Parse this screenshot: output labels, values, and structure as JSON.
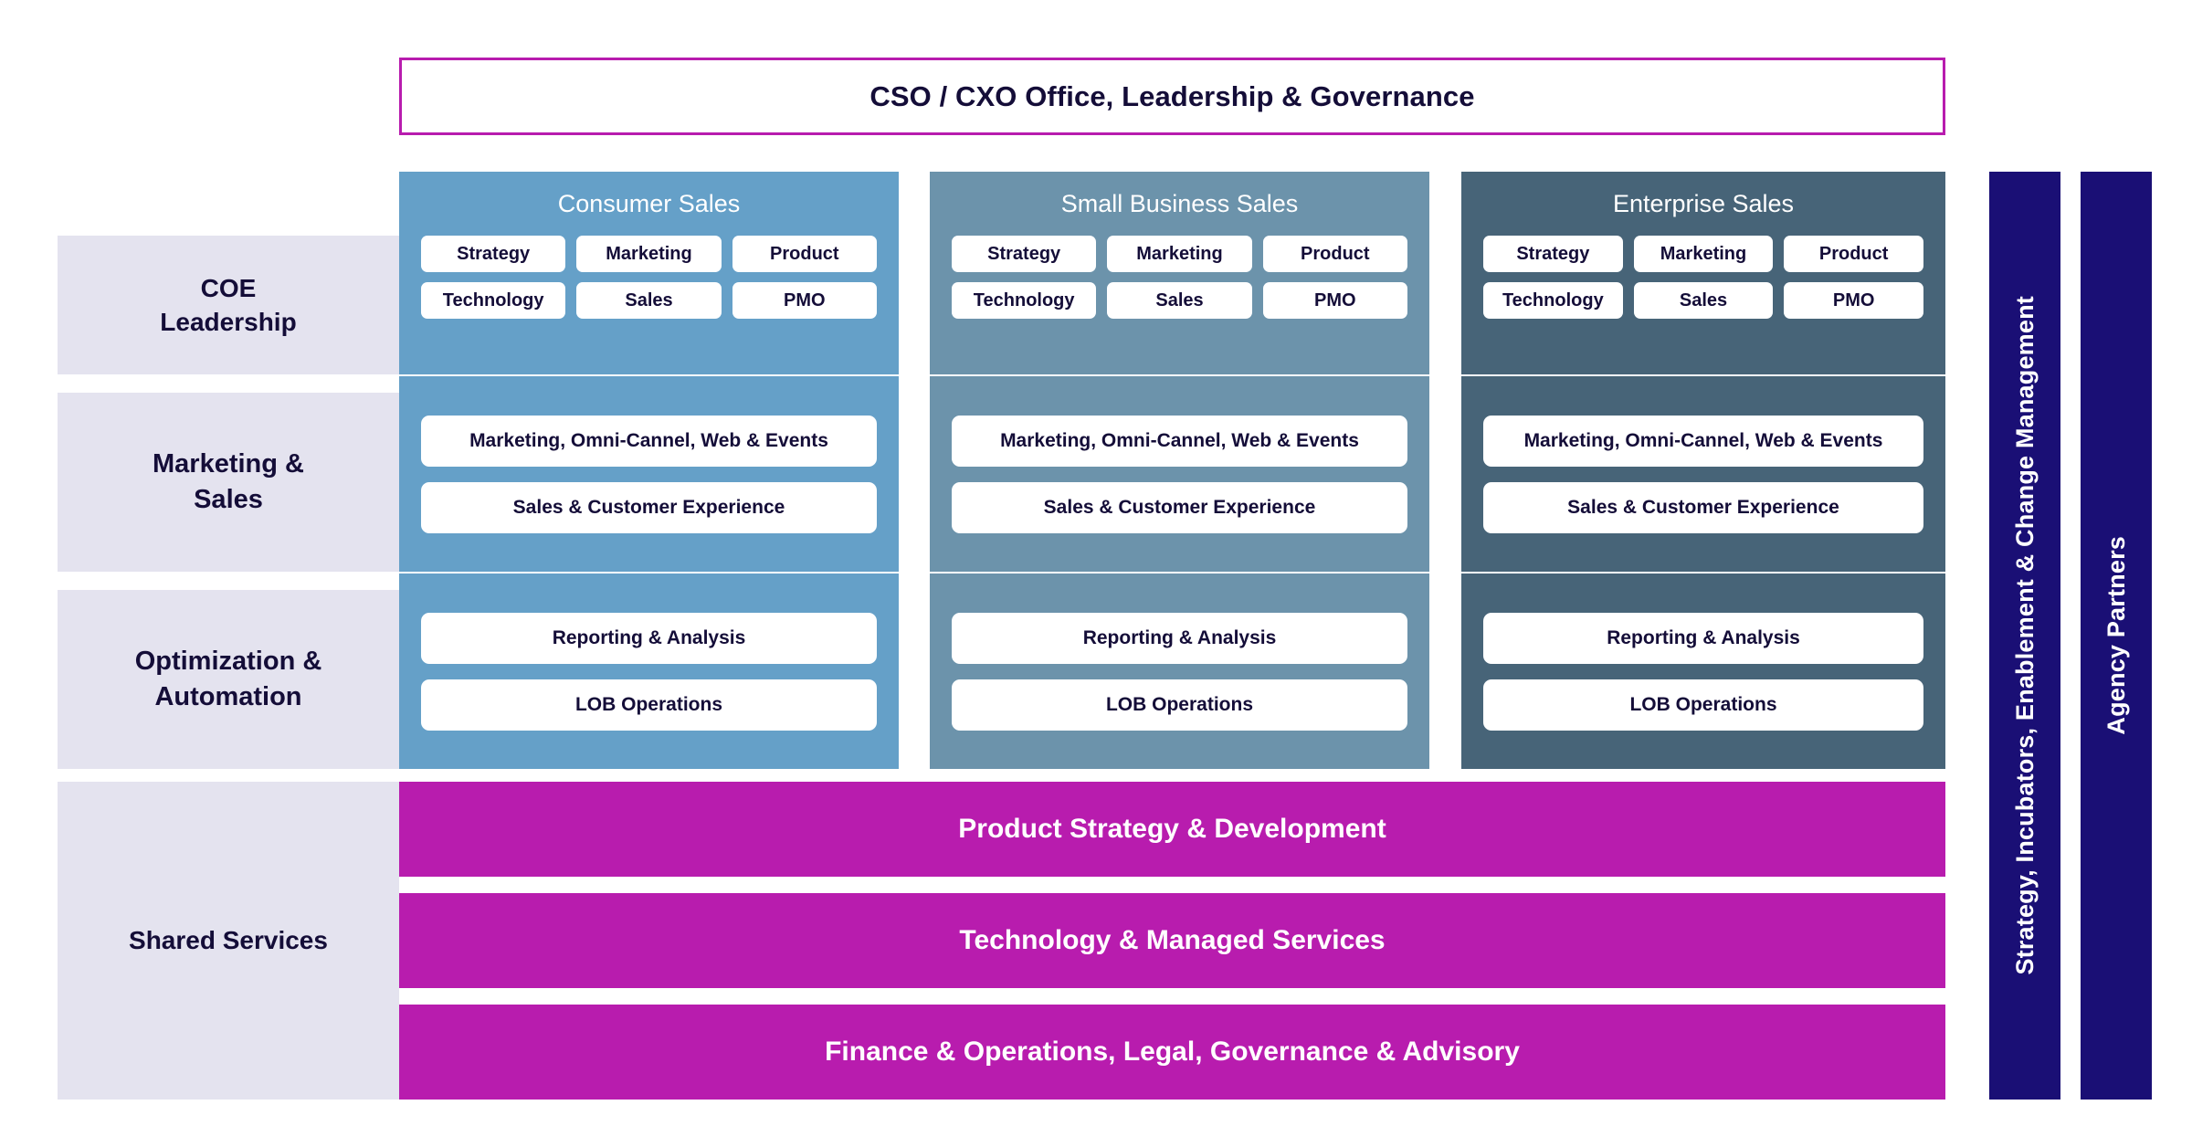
{
  "header": {
    "title": "CSO / CXO Office, Leadership & Governance"
  },
  "row_labels": {
    "coe": "COE\nLeadership",
    "coe_line1": "COE",
    "coe_line2": "Leadership",
    "marketing_line1": "Marketing &",
    "marketing_line2": "Sales",
    "optimization_line1": "Optimization &",
    "optimization_line2": "Automation",
    "shared": "Shared Services"
  },
  "columns": [
    {
      "id": "consumer",
      "title": "Consumer Sales",
      "color": "#65A0C8",
      "coe_chips": [
        "Strategy",
        "Marketing",
        "Product",
        "Technology",
        "Sales",
        "PMO"
      ],
      "marketing_cards": [
        "Marketing, Omni-Cannel, Web & Events",
        "Sales & Customer Experience"
      ],
      "optimization_cards": [
        "Reporting & Analysis",
        "LOB Operations"
      ]
    },
    {
      "id": "small-business",
      "title": "Small Business Sales",
      "color": "#6C93AB",
      "coe_chips": [
        "Strategy",
        "Marketing",
        "Product",
        "Technology",
        "Sales",
        "PMO"
      ],
      "marketing_cards": [
        "Marketing, Omni-Cannel, Web & Events",
        "Sales & Customer Experience"
      ],
      "optimization_cards": [
        "Reporting & Analysis",
        "LOB Operations"
      ]
    },
    {
      "id": "enterprise",
      "title": "Enterprise Sales",
      "color": "#476478",
      "coe_chips": [
        "Strategy",
        "Marketing",
        "Product",
        "Technology",
        "Sales",
        "PMO"
      ],
      "marketing_cards": [
        "Marketing, Omni-Cannel, Web & Events",
        "Sales & Customer Experience"
      ],
      "optimization_cards": [
        "Reporting & Analysis",
        "LOB Operations"
      ]
    }
  ],
  "shared_services": [
    "Product Strategy & Development",
    "Technology & Managed Services",
    "Finance & Operations, Legal, Governance & Advisory"
  ],
  "vertical_bars": [
    "Strategy, Incubators, Enablement & Change Management",
    "Agency Partners"
  ],
  "colors": {
    "accent_magenta": "#B81CAE",
    "navy": "#1A0F75",
    "lavender_band": "#E4E3EF",
    "text_dark": "#140D38",
    "consumer_blue": "#65A0C8",
    "small_business_blue": "#6C93AB",
    "enterprise_slate": "#476478"
  }
}
